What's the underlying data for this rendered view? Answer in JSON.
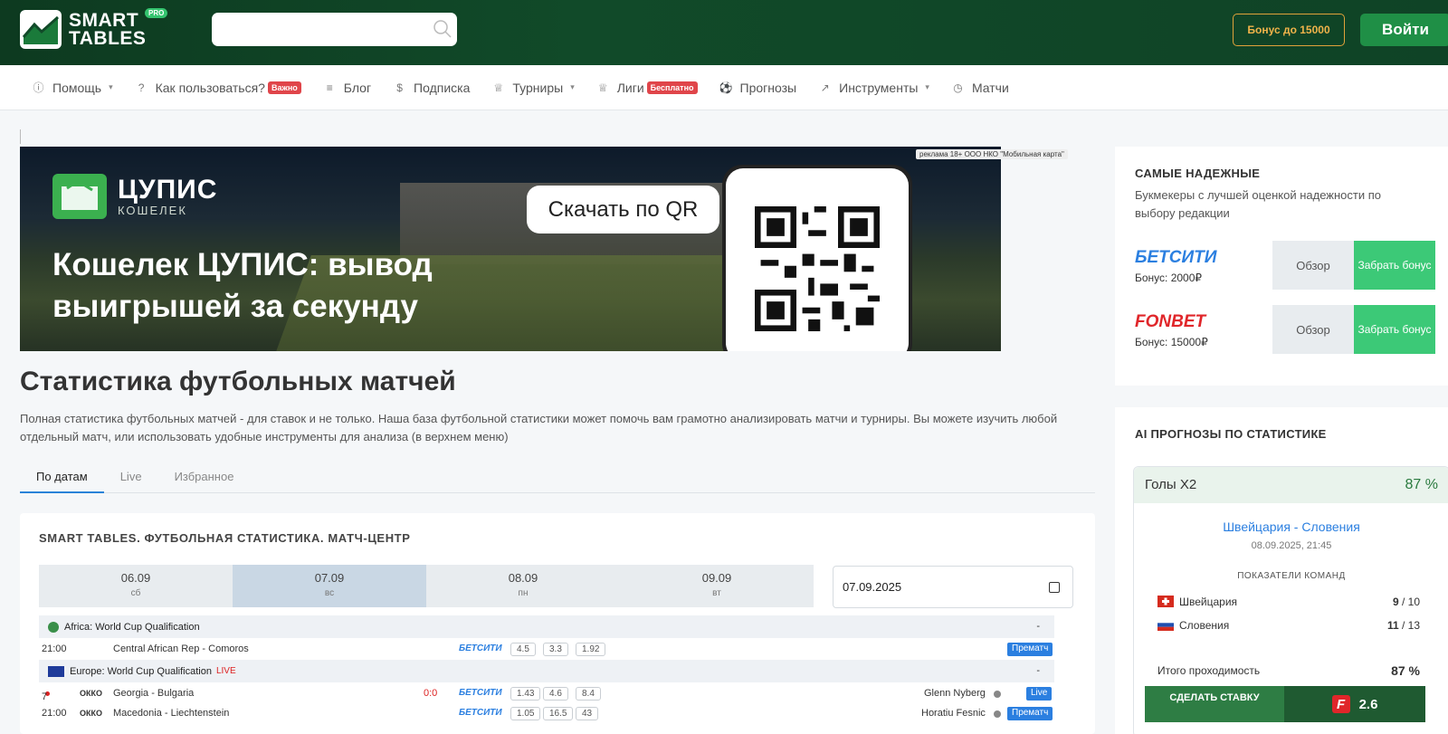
{
  "header": {
    "logo_line1": "SMART",
    "logo_line2": "TABLES",
    "logo_badge": "PRO",
    "search_placeholder": "",
    "bonus_label": "Бонус до 15000",
    "login_label": "Войти"
  },
  "nav": {
    "items": [
      {
        "label": "Помощь",
        "icon": "help-circle-icon",
        "dropdown": true
      },
      {
        "label": "Как пользоваться?",
        "icon": "question-icon",
        "badge": "Важно"
      },
      {
        "label": "Блог",
        "icon": "list-icon"
      },
      {
        "label": "Подписка",
        "icon": "dollar-icon"
      },
      {
        "label": "Турниры",
        "icon": "trophy-icon",
        "dropdown": true
      },
      {
        "label": "Лиги",
        "icon": "trophy-icon",
        "badge": "Бесплатно"
      },
      {
        "label": "Прогнозы",
        "icon": "ball-icon"
      },
      {
        "label": "Инструменты",
        "icon": "chart-icon",
        "dropdown": true
      },
      {
        "label": "Матчи",
        "icon": "clock-icon"
      }
    ]
  },
  "banner": {
    "brand": "ЦУПИС",
    "brand_sub": "КОШЕЛЕК",
    "headline": "Кошелек ЦУПИС: вывод выигрышей за секунду",
    "cta": "Скачать по QR",
    "ad_note": "реклама 18+ ООО НКО \"Мобильная карта\""
  },
  "page": {
    "title": "Статистика футбольных матчей",
    "description": "Полная статистика футбольных матчей - для ставок и не только. Наша база футбольной статистики может помочь вам грамотно анализировать матчи и турниры. Вы можете изучить любой отдельный матч, или использовать удобные инструменты для анализа (в верхнем меню)"
  },
  "tabs": [
    "По датам",
    "Live",
    "Избранное"
  ],
  "match_center": {
    "title": "SMART TABLES. ФУТБОЛЬНАЯ СТАТИСТИКА. МАТЧ-ЦЕНТР",
    "dates": [
      {
        "date": "06.09",
        "day": "сб"
      },
      {
        "date": "07.09",
        "day": "вс",
        "active": true
      },
      {
        "date": "08.09",
        "day": "пн"
      },
      {
        "date": "09.09",
        "day": "вт"
      }
    ],
    "date_input_value": "07.09.2025",
    "leagues": [
      {
        "name": "Africa: World Cup Qualification",
        "live": "",
        "dash": "-"
      },
      {
        "name": "Europe: World Cup Qualification",
        "live": "LIVE",
        "dash": "-"
      }
    ],
    "matches": [
      {
        "time": "21:00",
        "teams": "Central African Rep - Comoros",
        "bookmaker": "БЕТСИТИ",
        "odds": [
          "4.5",
          "3.3",
          "1.92"
        ],
        "tag": "Прематч"
      },
      {
        "time": "7",
        "tv": "ОККО",
        "teams": "Georgia - Bulgaria",
        "score": "0:0",
        "bookmaker": "БЕТСИТИ",
        "odds": [
          "1.43",
          "4.6",
          "8.4"
        ],
        "referee": "Glenn Nyberg",
        "tag": "Live"
      },
      {
        "time": "21:00",
        "tv": "ОККО",
        "teams": "Macedonia - Liechtenstein",
        "bookmaker": "БЕТСИТИ",
        "odds": [
          "1.05",
          "16.5",
          "43"
        ],
        "referee": "Horatiu Fesnic",
        "tag": "Прематч"
      }
    ]
  },
  "sidebar": {
    "reliable": {
      "title": "САМЫЕ НАДЕЖНЫЕ",
      "subtitle": "Букмекеры с лучшей оценкой надежности по выбору редакции",
      "bookmakers": [
        {
          "name": "БЕТСИТИ",
          "bonus": "Бонус: 2000₽",
          "review": "Обзор",
          "get": "Забрать бонус",
          "color": "#2b7fe0"
        },
        {
          "name": "FONBET",
          "bonus": "Бонус: 15000₽",
          "review": "Обзор",
          "get": "Забрать бонус",
          "color": "#e0262a"
        }
      ]
    },
    "ai": {
      "title": "AI ПРОГНОЗЫ ПО СТАТИСТИКЕ",
      "market": "Голы Х2",
      "probability": "87 %",
      "match": "Швейцария - Словения",
      "datetime": "08.09.2025, 21:45",
      "indicators_title": "ПОКАЗАТЕЛИ КОМАНД",
      "team1": {
        "name": "Швейцария",
        "score": "9",
        "total": " / 10"
      },
      "team2": {
        "name": "Словения",
        "score": "11",
        "total": " / 13"
      },
      "total_label": "Итого проходимость",
      "total_value": "87 %",
      "bet_label": "СДЕЛАТЬ СТАВКУ",
      "bet_odd": "2.6"
    }
  },
  "colors": {
    "header_green": "#114a29",
    "accent_green": "#3cc977",
    "link_blue": "#2b7fe0",
    "live_red": "#dd2222",
    "bonus_orange": "#e0a23a"
  }
}
